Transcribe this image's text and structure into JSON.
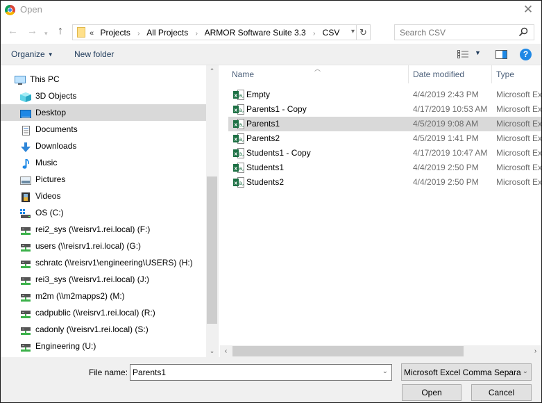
{
  "window": {
    "title": "Open",
    "close_glyph": "✕"
  },
  "nav": {
    "back_glyph": "←",
    "forward_glyph": "→",
    "recent_glyph": "⌄",
    "up_glyph": "↑",
    "overflow_glyph": "«",
    "separator_glyph": "›",
    "breadcrumb": [
      "Projects",
      "All Projects",
      "ARMOR Software Suite 3.3",
      "CSV"
    ],
    "dropdown_glyph": "⌄",
    "refresh_glyph": "↻",
    "search_placeholder": "Search CSV"
  },
  "toolbar": {
    "organize_label": "Organize",
    "organize_caret": "▼",
    "new_folder_label": "New folder",
    "view_caret": "▼",
    "help_glyph": "?"
  },
  "sidebar": {
    "items": [
      {
        "label": "This PC",
        "icon": "computer-icon",
        "level": 0
      },
      {
        "label": "3D Objects",
        "icon": "cube-icon",
        "level": 1
      },
      {
        "label": "Desktop",
        "icon": "desktop-icon",
        "level": 1,
        "selected": true
      },
      {
        "label": "Documents",
        "icon": "document-icon",
        "level": 1
      },
      {
        "label": "Downloads",
        "icon": "download-icon",
        "level": 1
      },
      {
        "label": "Music",
        "icon": "music-icon",
        "level": 1
      },
      {
        "label": "Pictures",
        "icon": "picture-icon",
        "level": 1
      },
      {
        "label": "Videos",
        "icon": "video-icon",
        "level": 1
      },
      {
        "label": "OS (C:)",
        "icon": "local-drive-icon",
        "level": 1
      },
      {
        "label": "rei2_sys (\\\\reisrv1.rei.local) (F:)",
        "icon": "network-drive-icon",
        "level": 1
      },
      {
        "label": "users (\\\\reisrv1.rei.local) (G:)",
        "icon": "network-drive-icon",
        "level": 1
      },
      {
        "label": "schratc (\\\\reisrv1\\engineering\\USERS) (H:)",
        "icon": "network-drive-icon",
        "level": 1
      },
      {
        "label": "rei3_sys (\\\\reisrv1.rei.local) (J:)",
        "icon": "network-drive-icon",
        "level": 1
      },
      {
        "label": "m2m (\\\\m2mapps2) (M:)",
        "icon": "network-drive-icon",
        "level": 1
      },
      {
        "label": "cadpublic (\\\\reisrv1.rei.local) (R:)",
        "icon": "network-drive-icon",
        "level": 1
      },
      {
        "label": "cadonly (\\\\reisrv1.rei.local) (S:)",
        "icon": "network-drive-icon",
        "level": 1
      },
      {
        "label": "Engineering (U:)",
        "icon": "network-drive-icon",
        "level": 1
      }
    ],
    "scroll_up_glyph": "︿",
    "scroll_down_glyph": "﹀"
  },
  "filelist": {
    "columns": [
      "Name",
      "Date modified",
      "Type"
    ],
    "sort_glyph": "︿",
    "files": [
      {
        "name": "Empty",
        "date": "4/4/2019 2:43 PM",
        "type": "Microsoft Excel Comma Separated Values File"
      },
      {
        "name": "Parents1 - Copy",
        "date": "4/17/2019 10:53 AM",
        "type": "Microsoft Excel Comma Separated Values File"
      },
      {
        "name": "Parents1",
        "date": "4/5/2019 9:08 AM",
        "type": "Microsoft Excel Comma Separated Values File",
        "selected": true
      },
      {
        "name": "Parents2",
        "date": "4/5/2019 1:41 PM",
        "type": "Microsoft Excel Comma Separated Values File"
      },
      {
        "name": "Students1 - Copy",
        "date": "4/17/2019 10:47 AM",
        "type": "Microsoft Excel Comma Separated Values File"
      },
      {
        "name": "Students1",
        "date": "4/4/2019 2:50 PM",
        "type": "Microsoft Excel Comma Separated Values File"
      },
      {
        "name": "Students2",
        "date": "4/4/2019 2:50 PM",
        "type": "Microsoft Excel Comma Separated Values File"
      }
    ],
    "hscroll_left_glyph": "‹",
    "hscroll_right_glyph": "›"
  },
  "footer": {
    "file_name_label": "File name:",
    "file_name_value": "Parents1",
    "file_name_dropdown_glyph": "⌄",
    "file_type_value": "Microsoft Excel Comma Separa",
    "file_type_caret": "⌄",
    "open_label": "Open",
    "cancel_label": "Cancel"
  },
  "colors": {
    "selection": "#d9d9d9",
    "accent": "#1e88e5",
    "excel_green": "#1d7044",
    "network_drive_green": "#3cb14a"
  }
}
